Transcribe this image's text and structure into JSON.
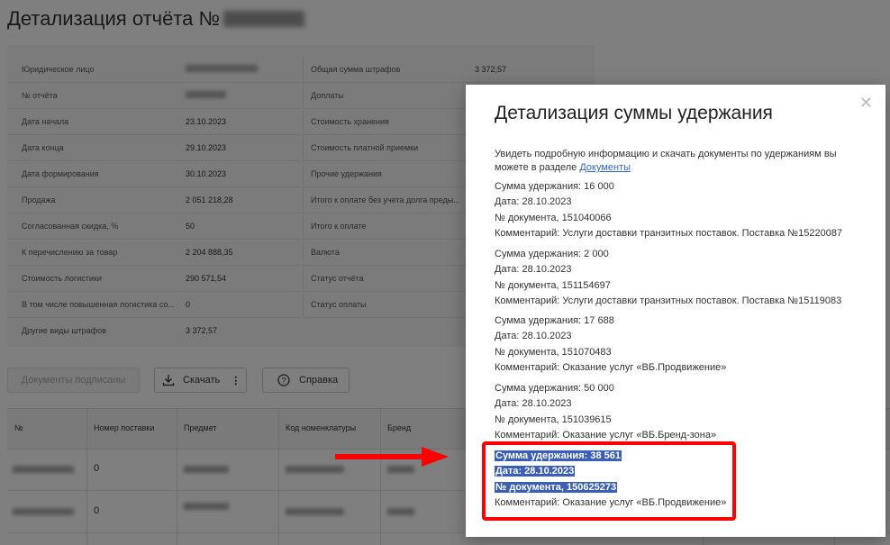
{
  "header": {
    "title": "Детализация отчёта №"
  },
  "report": {
    "left": [
      {
        "label": "Юридическое лицо",
        "value": ""
      },
      {
        "label": "№ отчёта",
        "value": ""
      },
      {
        "label": "Дата начала",
        "value": "23.10.2023"
      },
      {
        "label": "Дата конца",
        "value": "29.10.2023"
      },
      {
        "label": "Дата формирования",
        "value": "30.10.2023"
      },
      {
        "label": "Продажа",
        "value": "2 051 218,28"
      },
      {
        "label": "Согласованная скидка, %",
        "value": "50"
      },
      {
        "label": "К перечислению за товар",
        "value": "2 204 888,35"
      },
      {
        "label": "Стоимость логистики",
        "value": "290 571,54"
      },
      {
        "label": "В том числе повышенная логистика со...",
        "value": "0"
      },
      {
        "label": "Другие виды штрафов",
        "value": "3 372,57"
      }
    ],
    "right": [
      {
        "label": "Общая сумма штрафов",
        "value": "3 372,57"
      },
      {
        "label": "Доплаты",
        "value": ""
      },
      {
        "label": "Стоимость хранения",
        "value": ""
      },
      {
        "label": "Стоимость платной приемки",
        "value": ""
      },
      {
        "label": "Прочие удержания",
        "value": ""
      },
      {
        "label": "Итого к оплате без учета долга преды...",
        "value": ""
      },
      {
        "label": "Итого к оплате",
        "value": ""
      },
      {
        "label": "Валюта",
        "value": ""
      },
      {
        "label": "Статус отчёта",
        "value": ""
      },
      {
        "label": "Статус оплаты",
        "value": ""
      }
    ]
  },
  "toolbar": {
    "docs_signed": "Документы подписаны",
    "download": "Скачать",
    "help": "Справка"
  },
  "table": {
    "headers": [
      "№",
      "Номер поставки",
      "Предмет",
      "Код номенклатуры",
      "Бренд"
    ],
    "rows": [
      {
        "supply": "0"
      },
      {
        "supply": "0"
      }
    ]
  },
  "modal": {
    "title": "Детализация суммы удержания",
    "intro": "Увидеть подробную информацию и скачать документы по удержаниям вы можете в разделе",
    "intro_link": "Документы",
    "entries": [
      {
        "sum": "Сумма удержания: 16 000",
        "date": "Дата: 28.10.2023",
        "doc": "№ документа, 151040066",
        "comment": "Комментарий: Услуги доставки транзитных поставок. Поставка №15220087"
      },
      {
        "sum": "Сумма удержания: 2 000",
        "date": "Дата: 28.10.2023",
        "doc": "№ документа, 151154697",
        "comment": "Комментарий: Услуги доставки транзитных поставок. Поставка №15119083"
      },
      {
        "sum": "Сумма удержания: 17 688",
        "date": "Дата: 28.10.2023",
        "doc": "№ документа, 151070483",
        "comment": "Комментарий: Оказание услуг «ВБ.Продвижение»"
      },
      {
        "sum": "Сумма удержания: 50 000",
        "date": "Дата: 28.10.2023",
        "doc": "№ документа, 151039615",
        "comment": "Комментарий: Оказание услуг «ВБ.Бренд-зона»"
      },
      {
        "sum": "Сумма удержания: 38 561",
        "date": "Дата: 28.10.2023",
        "doc": "№ документа, 150625273",
        "comment": "Комментарий: Оказание услуг «ВБ.Продвижение»"
      }
    ]
  },
  "colors": {
    "highlight": "#3b5fb8",
    "annotation": "#ff0000",
    "link": "#3366cc"
  }
}
